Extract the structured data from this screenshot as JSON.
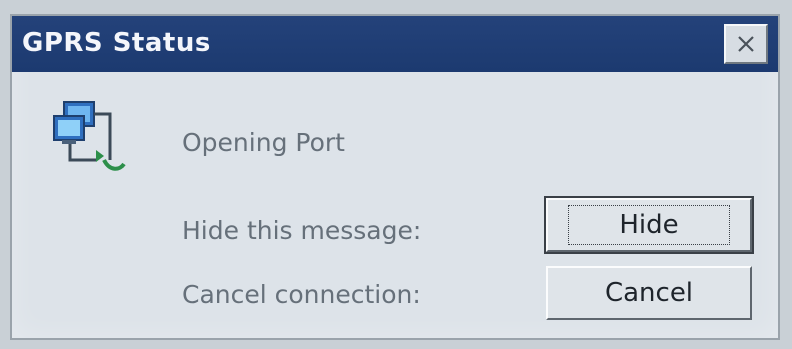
{
  "window": {
    "title": "GPRS Status",
    "close_icon": "close-icon"
  },
  "icon": "network-connection-icon",
  "status": {
    "text": "Opening Port"
  },
  "hide_row": {
    "label": "Hide this message:",
    "button_label": "Hide"
  },
  "cancel_row": {
    "label": "Cancel connection:",
    "button_label": "Cancel"
  },
  "colors": {
    "titlebar": "#1c3a70",
    "dialog_background": "#dde3e9",
    "label_text": "#66707a"
  }
}
